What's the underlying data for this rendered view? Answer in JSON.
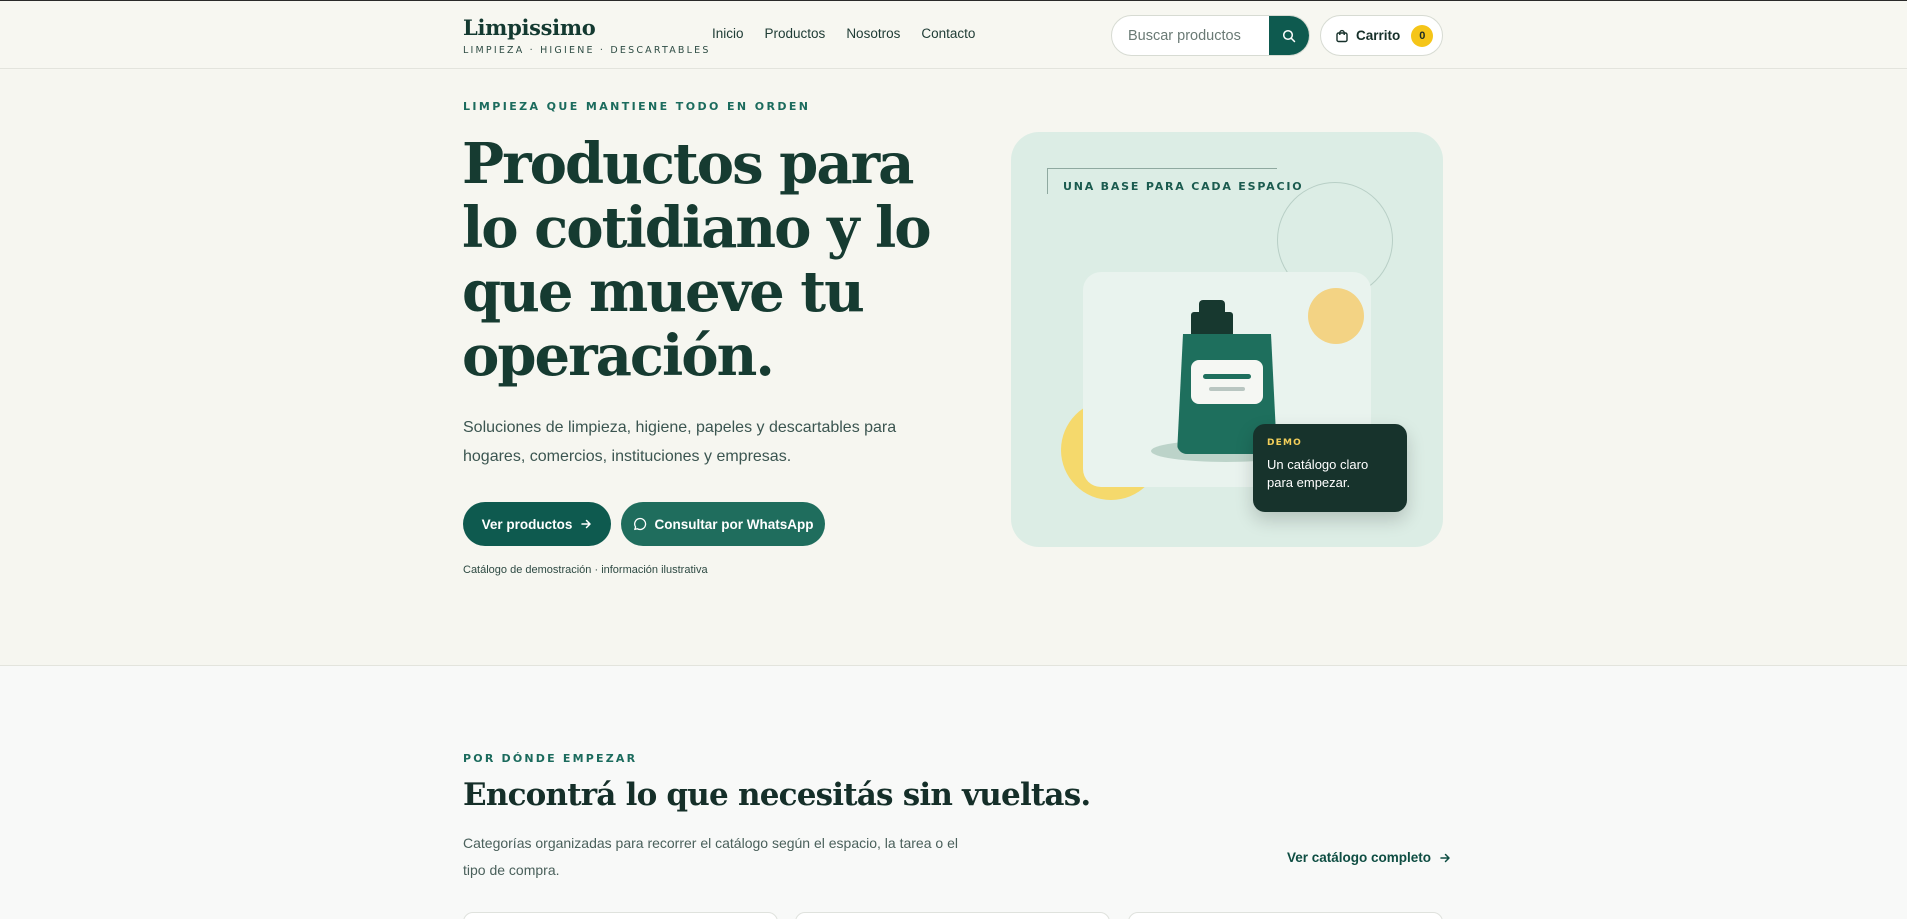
{
  "header": {
    "brand_name": "Limpissimo",
    "brand_tagline": "LIMPIEZA · HIGIENE · DESCARTABLES",
    "nav": [
      "Inicio",
      "Productos",
      "Nosotros",
      "Contacto"
    ],
    "search_placeholder": "Buscar productos",
    "cart_label": "Carrito",
    "cart_count": "0"
  },
  "hero": {
    "eyebrow": "LIMPIEZA QUE MANTIENE TODO EN ORDEN",
    "headline": "Productos para lo cotidiano y lo que mueve tu operación.",
    "subtext": "Soluciones de limpieza, higiene, papeles y descartables para hogares, comercios, instituciones y empresas.",
    "primary_button": "Ver productos",
    "secondary_button": "Consultar por WhatsApp",
    "note": "Catálogo de demostración · información ilustrativa"
  },
  "illustration": {
    "label": "UNA BASE PARA CADA ESPACIO",
    "demo_tag": "DEMO",
    "demo_text": "Un catálogo claro para empezar."
  },
  "section2": {
    "eyebrow": "POR DÓNDE EMPEZAR",
    "title": "Encontrá lo que necesitás sin vueltas.",
    "text": "Categorías organizadas para recorrer el catálogo según el espacio, la tarea o el tipo de compra.",
    "link": "Ver catálogo completo"
  },
  "colors": {
    "brand_green": "#0e5a4f",
    "accent_yellow": "#f5c518",
    "card_mint": "#dcede5"
  }
}
